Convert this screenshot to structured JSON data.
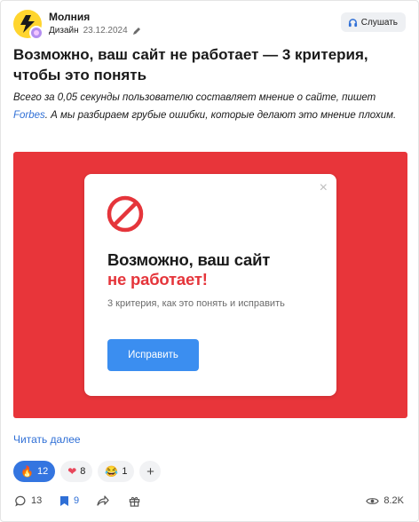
{
  "post": {
    "author": "Молния",
    "category": "Дизайн",
    "date": "23.12.2024",
    "listen_label": "Слушать",
    "title": "Возможно, ваш сайт не работает — 3 критерия, чтобы это понять",
    "lead_before": "Всего за 0,05 секунды пользователю составляет мнение о сайте, пишет ",
    "lead_link": "Forbes",
    "lead_after": ". А мы разбираем грубые ошибки, которые делают это мнение плохим.",
    "read_more": "Читать далее"
  },
  "hero": {
    "background_color": "#e8353a",
    "close_glyph": "×",
    "title_line1": "Возможно, ваш сайт",
    "title_line2": "не работает!",
    "text": "3 критерия, как это понять и исправить",
    "button_label": "Исправить"
  },
  "reactions": [
    {
      "icon": "fire-icon",
      "emoji": "🔥",
      "count": "12",
      "active": true
    },
    {
      "icon": "heart-icon",
      "emoji": "❤",
      "count": "8",
      "active": false
    },
    {
      "icon": "laughing-face-icon",
      "emoji": "😂",
      "count": "1",
      "active": false
    }
  ],
  "add_reaction_glyph": "+",
  "footer": {
    "comments": "13",
    "bookmarks": "9",
    "views": "8.2K"
  },
  "colors": {
    "accent_blue": "#3475e0",
    "link_blue": "#2f6fd6",
    "hero_red": "#e8353a",
    "avatar_yellow": "#ffd52e"
  }
}
